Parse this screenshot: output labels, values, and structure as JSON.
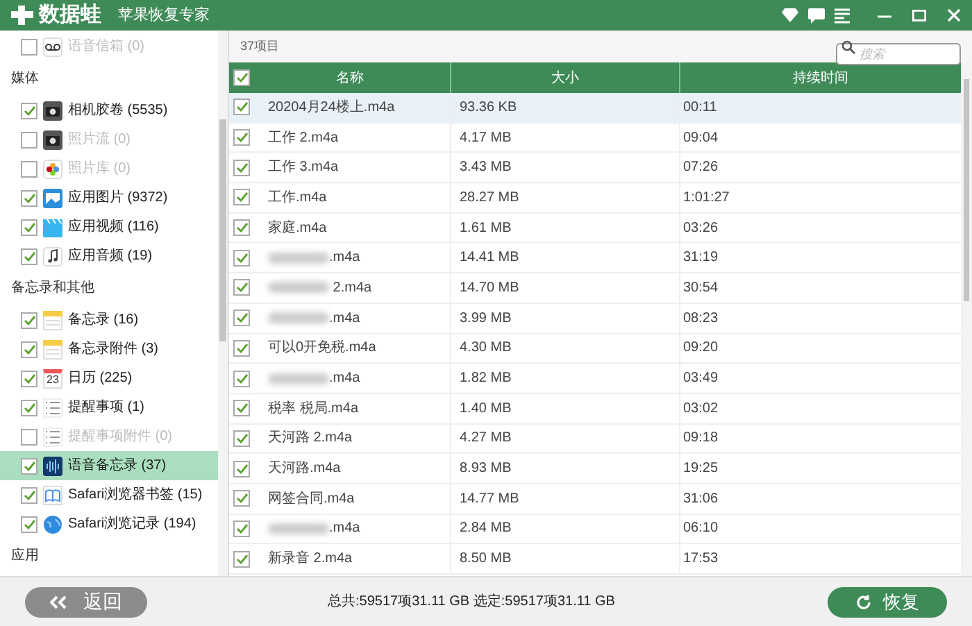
{
  "window": {
    "logo": "数据蛙",
    "title": "苹果恢复专家"
  },
  "sidebar": [
    {
      "kind": "item",
      "label": "语音信箱",
      "count": "(0)",
      "checked": false,
      "disabled": true,
      "selected": false
    },
    {
      "kind": "section",
      "label": "媒体"
    },
    {
      "kind": "item",
      "label": "相机胶卷",
      "count": "(5535)",
      "checked": true,
      "disabled": false,
      "selected": false
    },
    {
      "kind": "item",
      "label": "照片流",
      "count": "(0)",
      "checked": false,
      "disabled": true,
      "selected": false
    },
    {
      "kind": "item",
      "label": "照片库",
      "count": "(0)",
      "checked": false,
      "disabled": true,
      "selected": false
    },
    {
      "kind": "item",
      "label": "应用图片",
      "count": "(9372)",
      "checked": true,
      "disabled": false,
      "selected": false
    },
    {
      "kind": "item",
      "label": "应用视频",
      "count": "(116)",
      "checked": true,
      "disabled": false,
      "selected": false
    },
    {
      "kind": "item",
      "label": "应用音频",
      "count": "(19)",
      "checked": true,
      "disabled": false,
      "selected": false
    },
    {
      "kind": "section",
      "label": "备忘录和其他"
    },
    {
      "kind": "item",
      "label": "备忘录",
      "count": "(16)",
      "checked": true,
      "disabled": false,
      "selected": false
    },
    {
      "kind": "item",
      "label": "备忘录附件",
      "count": "(3)",
      "checked": true,
      "disabled": false,
      "selected": false
    },
    {
      "kind": "item",
      "label": "日历",
      "count": "(225)",
      "checked": true,
      "disabled": false,
      "selected": false,
      "icon_text": "23"
    },
    {
      "kind": "item",
      "label": "提醒事项",
      "count": "(1)",
      "checked": true,
      "disabled": false,
      "selected": false
    },
    {
      "kind": "item",
      "label": "提醒事项附件",
      "count": "(0)",
      "checked": false,
      "disabled": true,
      "selected": false
    },
    {
      "kind": "item",
      "label": "语音备忘录",
      "count": "(37)",
      "checked": true,
      "disabled": false,
      "selected": true
    },
    {
      "kind": "item",
      "label": "Safari浏览器书签",
      "count": "(15)",
      "checked": true,
      "disabled": false,
      "selected": false
    },
    {
      "kind": "item",
      "label": "Safari浏览记录",
      "count": "(194)",
      "checked": true,
      "disabled": false,
      "selected": false
    },
    {
      "kind": "section",
      "label": "应用"
    }
  ],
  "toolbar": {
    "item_count": "37项目",
    "search": {
      "placeholder": "搜索"
    }
  },
  "table": {
    "all_checked": true,
    "columns": [
      "名称",
      "大小",
      "持续时间"
    ],
    "rows": [
      {
        "checked": true,
        "selected": true,
        "redacted": false,
        "name": "20204月24楼上.m4a",
        "size": "93.36 KB",
        "duration": "00:11"
      },
      {
        "checked": true,
        "selected": false,
        "redacted": false,
        "name": "工作 2.m4a",
        "size": "4.17 MB",
        "duration": "09:04"
      },
      {
        "checked": true,
        "selected": false,
        "redacted": false,
        "name": "工作 3.m4a",
        "size": "3.43 MB",
        "duration": "07:26"
      },
      {
        "checked": true,
        "selected": false,
        "redacted": false,
        "name": "工作.m4a",
        "size": "28.27 MB",
        "duration": "1:01:27"
      },
      {
        "checked": true,
        "selected": false,
        "redacted": false,
        "name": "家庭.m4a",
        "size": "1.61 MB",
        "duration": "03:26"
      },
      {
        "checked": true,
        "selected": false,
        "redacted": true,
        "name": ".m4a",
        "size": "14.41 MB",
        "duration": "31:19"
      },
      {
        "checked": true,
        "selected": false,
        "redacted": true,
        "name": " 2.m4a",
        "size": "14.70 MB",
        "duration": "30:54"
      },
      {
        "checked": true,
        "selected": false,
        "redacted": true,
        "name": ".m4a",
        "size": "3.99 MB",
        "duration": "08:23"
      },
      {
        "checked": true,
        "selected": false,
        "redacted": false,
        "name": "可以0开免税.m4a",
        "size": "4.30 MB",
        "duration": "09:20"
      },
      {
        "checked": true,
        "selected": false,
        "redacted": true,
        "name": ".m4a",
        "size": "1.82 MB",
        "duration": "03:49"
      },
      {
        "checked": true,
        "selected": false,
        "redacted": false,
        "name": "税率 税局.m4a",
        "size": "1.40 MB",
        "duration": "03:02"
      },
      {
        "checked": true,
        "selected": false,
        "redacted": false,
        "name": "天河路 2.m4a",
        "size": "4.27 MB",
        "duration": "09:18"
      },
      {
        "checked": true,
        "selected": false,
        "redacted": false,
        "name": "天河路.m4a",
        "size": "8.93 MB",
        "duration": "19:25"
      },
      {
        "checked": true,
        "selected": false,
        "redacted": false,
        "name": "网签合同.m4a",
        "size": "14.77 MB",
        "duration": "31:06"
      },
      {
        "checked": true,
        "selected": false,
        "redacted": true,
        "name": ".m4a",
        "size": "2.84 MB",
        "duration": "06:10"
      },
      {
        "checked": true,
        "selected": false,
        "redacted": false,
        "name": "新录音 2.m4a",
        "size": "8.50 MB",
        "duration": "17:53"
      }
    ]
  },
  "footer": {
    "back_button": "返回",
    "summary": "总共:59517项31.11 GB 选定:59517项31.11 GB",
    "restore_button": "恢复"
  }
}
